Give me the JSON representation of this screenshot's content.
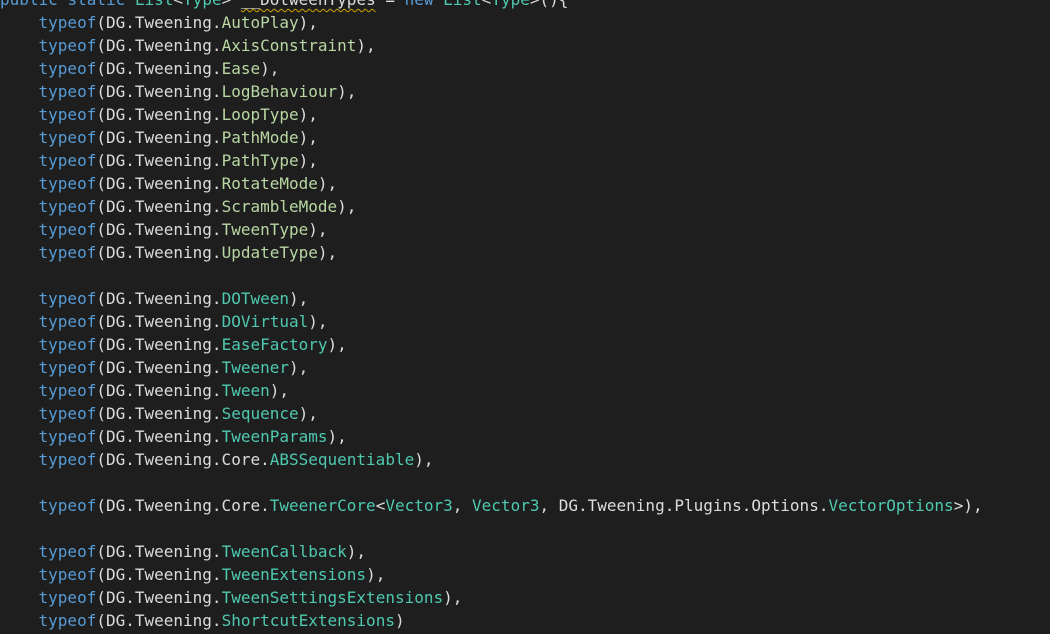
{
  "editor": {
    "lines": [
      [
        {
          "t": "public ",
          "c": "kw"
        },
        {
          "t": "static ",
          "c": "kw"
        },
        {
          "t": "List",
          "c": "type"
        },
        {
          "t": "<",
          "c": "txt"
        },
        {
          "t": "Type",
          "c": "type"
        },
        {
          "t": "> ",
          "c": "txt"
        },
        {
          "t": "__DotweenTypes",
          "c": "id",
          "sq": true
        },
        {
          "t": " = ",
          "c": "txt"
        },
        {
          "t": "new ",
          "c": "kw"
        },
        {
          "t": "List",
          "c": "type"
        },
        {
          "t": "<",
          "c": "txt"
        },
        {
          "t": "Type",
          "c": "type"
        },
        {
          "t": ">(){",
          "c": "txt"
        }
      ],
      [
        {
          "t": "    typeof",
          "c": "kw"
        },
        {
          "t": "(DG.Tweening.",
          "c": "txt"
        },
        {
          "t": "AutoPlay",
          "c": "enum"
        },
        {
          "t": "),",
          "c": "txt"
        }
      ],
      [
        {
          "t": "    typeof",
          "c": "kw"
        },
        {
          "t": "(DG.Tweening.",
          "c": "txt"
        },
        {
          "t": "AxisConstraint",
          "c": "enum"
        },
        {
          "t": "),",
          "c": "txt"
        }
      ],
      [
        {
          "t": "    typeof",
          "c": "kw"
        },
        {
          "t": "(DG.Tweening.",
          "c": "txt"
        },
        {
          "t": "Ease",
          "c": "enum"
        },
        {
          "t": "),",
          "c": "txt"
        }
      ],
      [
        {
          "t": "    typeof",
          "c": "kw"
        },
        {
          "t": "(DG.Tweening.",
          "c": "txt"
        },
        {
          "t": "LogBehaviour",
          "c": "enum"
        },
        {
          "t": "),",
          "c": "txt"
        }
      ],
      [
        {
          "t": "    typeof",
          "c": "kw"
        },
        {
          "t": "(DG.Tweening.",
          "c": "txt"
        },
        {
          "t": "LoopType",
          "c": "enum"
        },
        {
          "t": "),",
          "c": "txt"
        }
      ],
      [
        {
          "t": "    typeof",
          "c": "kw"
        },
        {
          "t": "(DG.Tweening.",
          "c": "txt"
        },
        {
          "t": "PathMode",
          "c": "enum"
        },
        {
          "t": "),",
          "c": "txt"
        }
      ],
      [
        {
          "t": "    typeof",
          "c": "kw"
        },
        {
          "t": "(DG.Tweening.",
          "c": "txt"
        },
        {
          "t": "PathType",
          "c": "enum"
        },
        {
          "t": "),",
          "c": "txt"
        }
      ],
      [
        {
          "t": "    typeof",
          "c": "kw"
        },
        {
          "t": "(DG.Tweening.",
          "c": "txt"
        },
        {
          "t": "RotateMode",
          "c": "enum"
        },
        {
          "t": "),",
          "c": "txt"
        }
      ],
      [
        {
          "t": "    typeof",
          "c": "kw"
        },
        {
          "t": "(DG.Tweening.",
          "c": "txt"
        },
        {
          "t": "ScrambleMode",
          "c": "enum"
        },
        {
          "t": "),",
          "c": "txt"
        }
      ],
      [
        {
          "t": "    typeof",
          "c": "kw"
        },
        {
          "t": "(DG.Tweening.",
          "c": "txt"
        },
        {
          "t": "TweenType",
          "c": "enum"
        },
        {
          "t": "),",
          "c": "txt"
        }
      ],
      [
        {
          "t": "    typeof",
          "c": "kw"
        },
        {
          "t": "(DG.Tweening.",
          "c": "txt"
        },
        {
          "t": "UpdateType",
          "c": "enum"
        },
        {
          "t": "),",
          "c": "txt"
        }
      ],
      [],
      [
        {
          "t": "    typeof",
          "c": "kw"
        },
        {
          "t": "(DG.Tweening.",
          "c": "txt"
        },
        {
          "t": "DOTween",
          "c": "type"
        },
        {
          "t": "),",
          "c": "txt"
        }
      ],
      [
        {
          "t": "    typeof",
          "c": "kw"
        },
        {
          "t": "(DG.Tweening.",
          "c": "txt"
        },
        {
          "t": "DOVirtual",
          "c": "type"
        },
        {
          "t": "),",
          "c": "txt"
        }
      ],
      [
        {
          "t": "    typeof",
          "c": "kw"
        },
        {
          "t": "(DG.Tweening.",
          "c": "txt"
        },
        {
          "t": "EaseFactory",
          "c": "type"
        },
        {
          "t": "),",
          "c": "txt"
        }
      ],
      [
        {
          "t": "    typeof",
          "c": "kw"
        },
        {
          "t": "(DG.Tweening.",
          "c": "txt"
        },
        {
          "t": "Tweener",
          "c": "type"
        },
        {
          "t": "),",
          "c": "txt"
        }
      ],
      [
        {
          "t": "    typeof",
          "c": "kw"
        },
        {
          "t": "(DG.Tweening.",
          "c": "txt"
        },
        {
          "t": "Tween",
          "c": "type"
        },
        {
          "t": "),",
          "c": "txt"
        }
      ],
      [
        {
          "t": "    typeof",
          "c": "kw"
        },
        {
          "t": "(DG.Tweening.",
          "c": "txt"
        },
        {
          "t": "Sequence",
          "c": "type"
        },
        {
          "t": "),",
          "c": "txt"
        }
      ],
      [
        {
          "t": "    typeof",
          "c": "kw"
        },
        {
          "t": "(DG.Tweening.",
          "c": "txt"
        },
        {
          "t": "TweenParams",
          "c": "type"
        },
        {
          "t": "),",
          "c": "txt"
        }
      ],
      [
        {
          "t": "    typeof",
          "c": "kw"
        },
        {
          "t": "(DG.Tweening.Core.",
          "c": "txt"
        },
        {
          "t": "ABSSequentiable",
          "c": "type"
        },
        {
          "t": "),",
          "c": "txt"
        }
      ],
      [],
      [
        {
          "t": "    typeof",
          "c": "kw"
        },
        {
          "t": "(DG.Tweening.Core.",
          "c": "txt"
        },
        {
          "t": "TweenerCore",
          "c": "type"
        },
        {
          "t": "<",
          "c": "txt"
        },
        {
          "t": "Vector3",
          "c": "type"
        },
        {
          "t": ", ",
          "c": "txt"
        },
        {
          "t": "Vector3",
          "c": "type"
        },
        {
          "t": ", DG.Tweening.Plugins.Options.",
          "c": "txt"
        },
        {
          "t": "VectorOptions",
          "c": "type"
        },
        {
          "t": ">),",
          "c": "txt"
        }
      ],
      [],
      [
        {
          "t": "    typeof",
          "c": "kw"
        },
        {
          "t": "(DG.Tweening.",
          "c": "txt"
        },
        {
          "t": "TweenCallback",
          "c": "type"
        },
        {
          "t": "),",
          "c": "txt"
        }
      ],
      [
        {
          "t": "    typeof",
          "c": "kw"
        },
        {
          "t": "(DG.Tweening.",
          "c": "txt"
        },
        {
          "t": "TweenExtensions",
          "c": "type"
        },
        {
          "t": "),",
          "c": "txt"
        }
      ],
      [
        {
          "t": "    typeof",
          "c": "kw"
        },
        {
          "t": "(DG.Tweening.",
          "c": "txt"
        },
        {
          "t": "TweenSettingsExtensions",
          "c": "type"
        },
        {
          "t": "),",
          "c": "txt"
        }
      ],
      [
        {
          "t": "    typeof",
          "c": "kw"
        },
        {
          "t": "(DG.Tweening.",
          "c": "txt"
        },
        {
          "t": "ShortcutExtensions",
          "c": "type"
        },
        {
          "t": ")",
          "c": "txt"
        }
      ]
    ]
  }
}
